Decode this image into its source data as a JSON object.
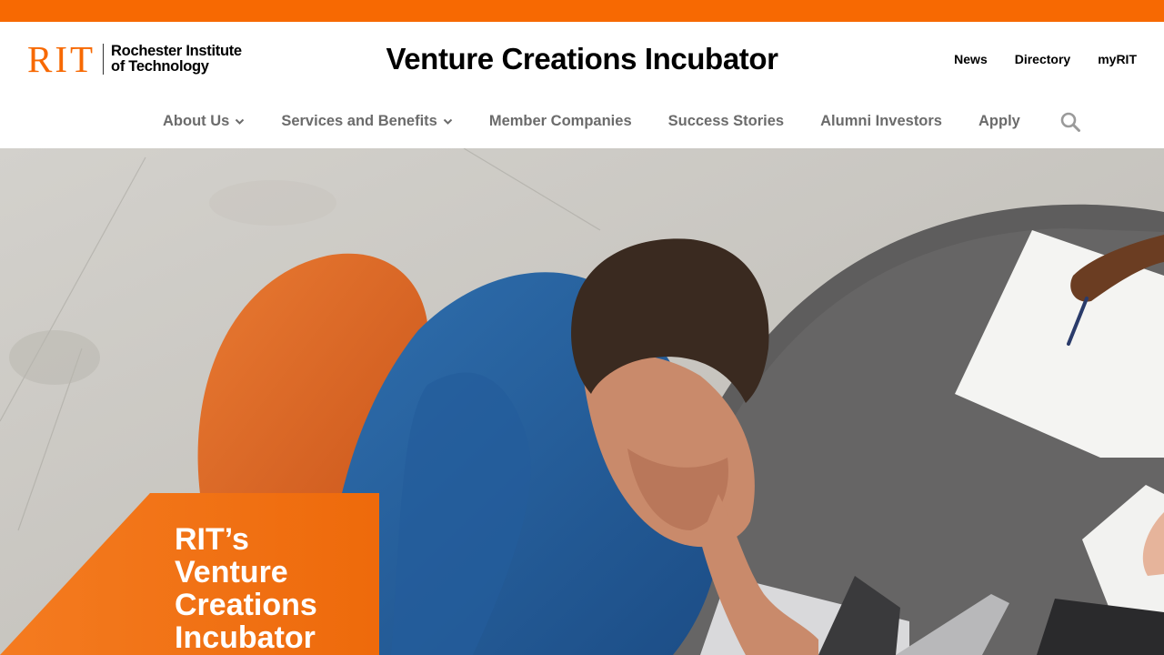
{
  "brand": {
    "primary_color": "#F76902",
    "logo": {
      "wordmark": "RIT",
      "line1": "Rochester Institute",
      "line2": "of Technology"
    }
  },
  "site_title": "Venture Creations Incubator",
  "utility_nav": [
    {
      "label": "News"
    },
    {
      "label": "Directory"
    },
    {
      "label": "myRIT"
    }
  ],
  "main_nav": [
    {
      "label": "About Us",
      "icon": "chevron-down-icon"
    },
    {
      "label": "Services and Benefits",
      "icon": "chevron-down-icon"
    },
    {
      "label": "Member Companies"
    },
    {
      "label": "Success Stories"
    },
    {
      "label": "Alumni Investors"
    },
    {
      "label": "Apply"
    }
  ],
  "search": {
    "icon": "search-icon"
  },
  "hero": {
    "heading": "RIT’s Venture Creations Incubator"
  }
}
